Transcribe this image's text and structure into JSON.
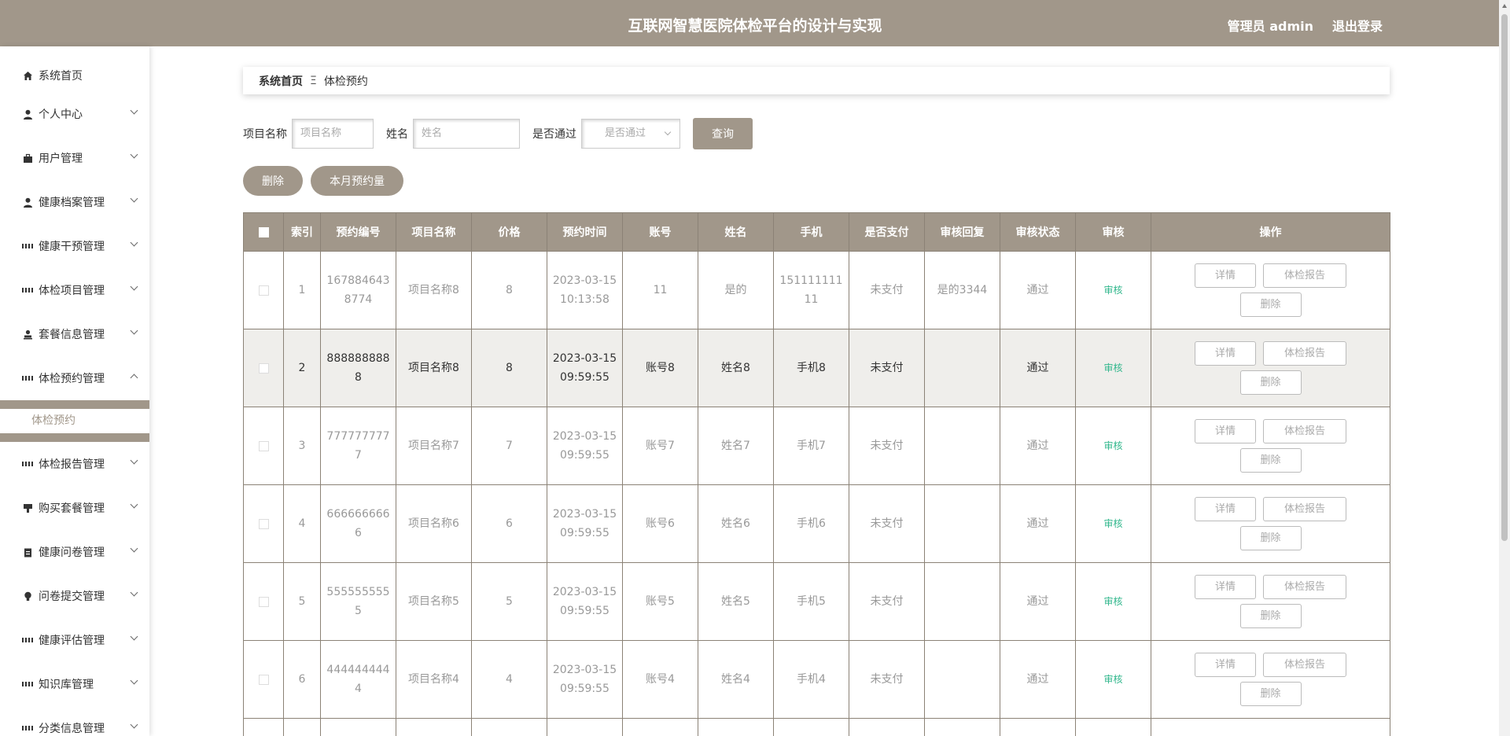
{
  "header": {
    "title": "互联网智慧医院体检平台的设计与实现",
    "admin_label": "管理员 admin",
    "logout_label": "退出登录"
  },
  "sidebar": {
    "items": [
      {
        "label": "系统首页",
        "icon": "home-icon"
      },
      {
        "label": "个人中心",
        "icon": "user-icon"
      },
      {
        "label": "用户管理",
        "icon": "briefcase-icon"
      },
      {
        "label": "健康档案管理",
        "icon": "user-icon"
      },
      {
        "label": "健康干预管理",
        "icon": "grid-icon"
      },
      {
        "label": "体检项目管理",
        "icon": "grid-icon"
      },
      {
        "label": "套餐信息管理",
        "icon": "person-icon"
      },
      {
        "label": "体检预约管理",
        "icon": "grid-icon"
      },
      {
        "label": "体检报告管理",
        "icon": "grid-icon"
      },
      {
        "label": "购买套餐管理",
        "icon": "cup-icon"
      },
      {
        "label": "健康问卷管理",
        "icon": "clipboard-icon"
      },
      {
        "label": "问卷提交管理",
        "icon": "bulb-icon"
      },
      {
        "label": "健康评估管理",
        "icon": "grid-icon"
      },
      {
        "label": "知识库管理",
        "icon": "grid-icon"
      },
      {
        "label": "分类信息管理",
        "icon": "grid-icon"
      }
    ],
    "submenu": {
      "label": "体检预约"
    }
  },
  "breadcrumb": {
    "home": "系统首页",
    "separator": "Ξ",
    "current": "体检预约"
  },
  "search": {
    "project_label": "项目名称",
    "project_placeholder": "项目名称",
    "name_label": "姓名",
    "name_placeholder": "姓名",
    "passed_label": "是否通过",
    "passed_placeholder": "是否通过",
    "query_button": "查询"
  },
  "actions": {
    "delete_button": "删除",
    "monthly_button": "本月预约量"
  },
  "table": {
    "headers": [
      "索引",
      "预约编号",
      "项目名称",
      "价格",
      "预约时间",
      "账号",
      "姓名",
      "手机",
      "是否支付",
      "审核回复",
      "审核状态",
      "审核",
      "操作"
    ],
    "detail_label": "详情",
    "report_label": "体检报告",
    "delete_label": "删除",
    "rows": [
      {
        "index": "1",
        "no": "1678846438774",
        "project": "项目名称8",
        "price": "8",
        "time": "2023-03-15 10:13:58",
        "account": "11",
        "name": "是的",
        "phone": "15111111111",
        "paid": "未支付",
        "reply": "是的3344",
        "status": "通过",
        "audit": "审核"
      },
      {
        "index": "2",
        "no": "8888888888",
        "project": "项目名称8",
        "price": "8",
        "time": "2023-03-15 09:59:55",
        "account": "账号8",
        "name": "姓名8",
        "phone": "手机8",
        "paid": "未支付",
        "reply": "",
        "status": "通过",
        "audit": "审核"
      },
      {
        "index": "3",
        "no": "7777777777",
        "project": "项目名称7",
        "price": "7",
        "time": "2023-03-15 09:59:55",
        "account": "账号7",
        "name": "姓名7",
        "phone": "手机7",
        "paid": "未支付",
        "reply": "",
        "status": "通过",
        "audit": "审核"
      },
      {
        "index": "4",
        "no": "6666666666",
        "project": "项目名称6",
        "price": "6",
        "time": "2023-03-15 09:59:55",
        "account": "账号6",
        "name": "姓名6",
        "phone": "手机6",
        "paid": "未支付",
        "reply": "",
        "status": "通过",
        "audit": "审核"
      },
      {
        "index": "5",
        "no": "5555555555",
        "project": "项目名称5",
        "price": "5",
        "time": "2023-03-15 09:59:55",
        "account": "账号5",
        "name": "姓名5",
        "phone": "手机5",
        "paid": "未支付",
        "reply": "",
        "status": "通过",
        "audit": "审核"
      },
      {
        "index": "6",
        "no": "4444444444",
        "project": "项目名称4",
        "price": "4",
        "time": "2023-03-15 09:59:55",
        "account": "账号4",
        "name": "姓名4",
        "phone": "手机4",
        "paid": "未支付",
        "reply": "",
        "status": "通过",
        "audit": "审核"
      }
    ]
  }
}
